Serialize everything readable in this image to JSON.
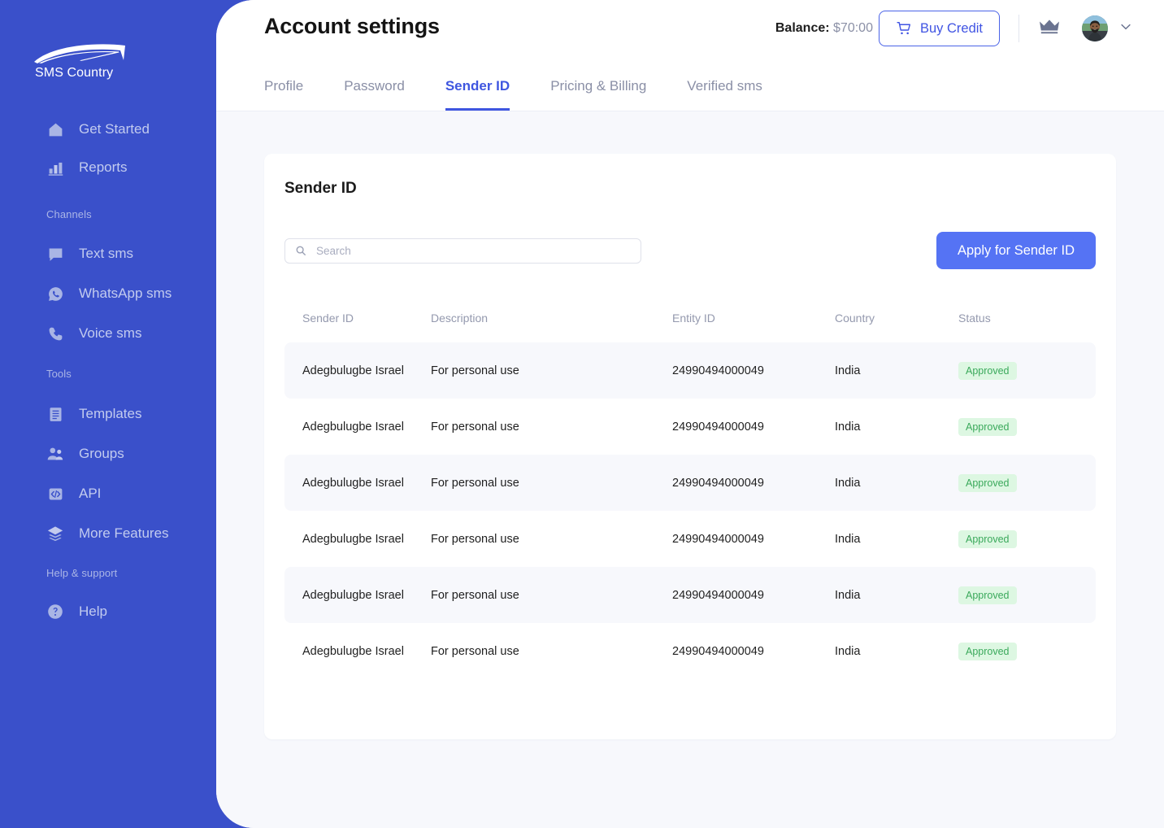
{
  "brand": {
    "logo_text": "SMS Country",
    "logo_icon": "paper-plane-swoosh-icon",
    "sidebar_bg": "#3a50ca",
    "accent": "#3f56e0",
    "primary_button": "#5573f4"
  },
  "sidebar": {
    "groups": [
      {
        "label": "",
        "items": [
          {
            "label": "Get Started",
            "icon": "home-icon"
          },
          {
            "label": "Reports",
            "icon": "bar-chart-icon"
          }
        ]
      },
      {
        "label": "Channels",
        "items": [
          {
            "label": "Text sms",
            "icon": "chat-bubble-icon"
          },
          {
            "label": "WhatsApp sms",
            "icon": "whatsapp-icon"
          },
          {
            "label": "Voice sms",
            "icon": "phone-icon"
          }
        ]
      },
      {
        "label": "Tools",
        "items": [
          {
            "label": "Templates",
            "icon": "document-icon"
          },
          {
            "label": "Groups",
            "icon": "people-icon"
          },
          {
            "label": "API",
            "icon": "code-icon"
          },
          {
            "label": "More Features",
            "icon": "layers-icon"
          }
        ]
      },
      {
        "label": "Help & support",
        "items": [
          {
            "label": "Help",
            "icon": "question-circle-icon"
          }
        ]
      }
    ]
  },
  "header": {
    "title": "Account settings",
    "balance_label": "Balance:",
    "balance_amount": "$70:00",
    "buy_credit_label": "Buy Credit",
    "buy_credit_icon": "shopping-cart-icon",
    "crown_icon": "crown-icon",
    "avatar_icon": "user-avatar",
    "chevron_icon": "chevron-down-icon"
  },
  "tabs": [
    {
      "label": "Profile",
      "active": false
    },
    {
      "label": "Password",
      "active": false
    },
    {
      "label": "Sender ID",
      "active": true
    },
    {
      "label": "Pricing & Billing",
      "active": false
    },
    {
      "label": "Verified sms",
      "active": false
    }
  ],
  "card": {
    "title": "Sender ID",
    "search": {
      "value": "",
      "placeholder": "Search",
      "icon": "search-icon"
    },
    "apply_button_label": "Apply for Sender ID"
  },
  "table": {
    "columns": [
      "Sender ID",
      "Description",
      "Entity ID",
      "Country",
      "Status"
    ],
    "rows": [
      {
        "sender_id": "Adegbulugbe Israel",
        "description": "For personal use",
        "entity_id": "24990494000049",
        "country": "India",
        "status": "Approved"
      },
      {
        "sender_id": "Adegbulugbe Israel",
        "description": "For personal use",
        "entity_id": "24990494000049",
        "country": "India",
        "status": "Approved"
      },
      {
        "sender_id": "Adegbulugbe Israel",
        "description": "For personal use",
        "entity_id": "24990494000049",
        "country": "India",
        "status": "Approved"
      },
      {
        "sender_id": "Adegbulugbe Israel",
        "description": "For personal use",
        "entity_id": "24990494000049",
        "country": "India",
        "status": "Approved"
      },
      {
        "sender_id": "Adegbulugbe Israel",
        "description": "For personal use",
        "entity_id": "24990494000049",
        "country": "India",
        "status": "Approved"
      },
      {
        "sender_id": "Adegbulugbe Israel",
        "description": "For personal use",
        "entity_id": "24990494000049",
        "country": "India",
        "status": "Approved"
      }
    ],
    "status_colors": {
      "approved_bg": "#ddf7e2",
      "approved_text": "#3aa95b"
    }
  }
}
